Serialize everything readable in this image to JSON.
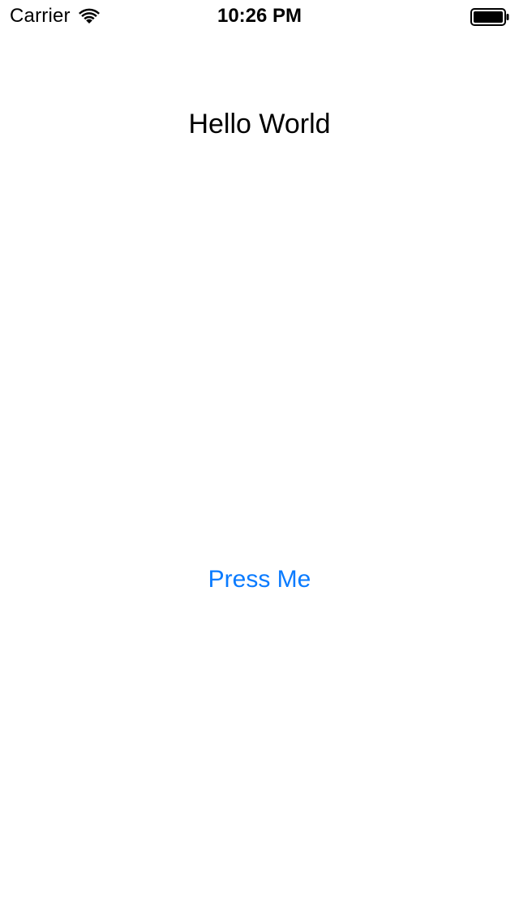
{
  "status_bar": {
    "carrier": "Carrier",
    "time": "10:26 PM",
    "icons": {
      "wifi": "wifi-icon",
      "battery": "battery-icon"
    }
  },
  "main": {
    "label": "Hello World",
    "button_label": "Press Me"
  },
  "colors": {
    "background": "#ffffff",
    "text": "#000000",
    "tint": "#0a7bff"
  }
}
